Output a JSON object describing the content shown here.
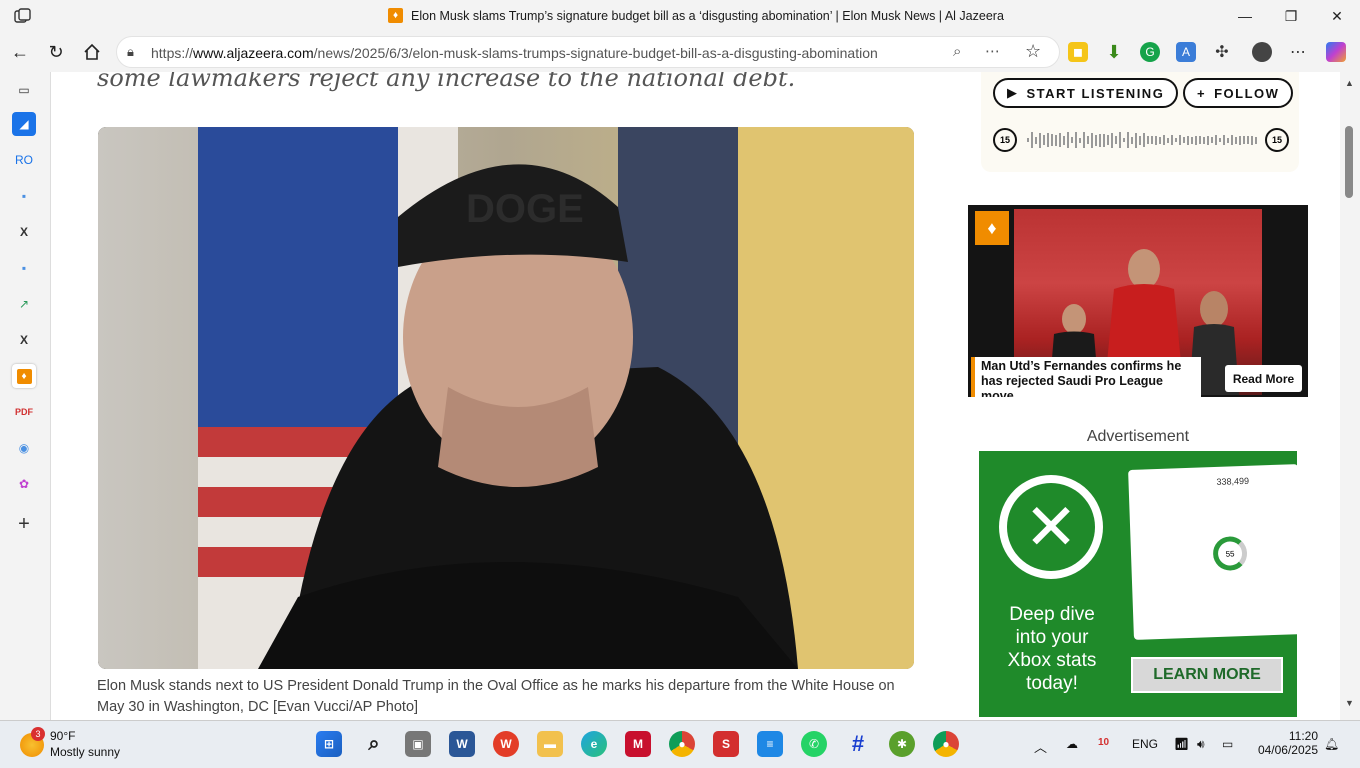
{
  "window": {
    "title": "Elon Musk slams Trump’s signature budget bill as a ‘disgusting abomination’ | Elon Musk News | Al Jazeera",
    "favicon_icon": "al-jazeera-icon"
  },
  "toolbar": {
    "url_prefix": "https://",
    "url_domain": "www.aljazeera.com",
    "url_path": "/news/2025/6/3/elon-musk-slams-trumps-signature-budget-bill-as-a-disgusting-abomination"
  },
  "article": {
    "deck": "some lawmakers reject any increase to the national debt.",
    "image_text": "DOGE",
    "caption": "Elon Musk stands next to US President Donald Trump in the Oval Office as he marks his departure from the White House on May 30 in Washington, DC [Evan Vucci/AP Photo]"
  },
  "audio": {
    "listen_label": "START LISTENING",
    "follow_label": "FOLLOW",
    "skip_back": "15",
    "skip_forward": "15"
  },
  "promo": {
    "headline": "Man Utd’s Fernandes confirms he has rejected Saudi Pro League move",
    "read_more": "Read More"
  },
  "ad": {
    "label": "Advertisement",
    "text": "Deep dive into your Xbox stats today!",
    "button": "LEARN MORE",
    "stat_number": "338,499",
    "ring_value": "55"
  },
  "taskbar": {
    "weather_badge": "3",
    "temperature": "90°F",
    "condition": "Mostly sunny",
    "language": "ENG",
    "time": "11:20",
    "date": "04/06/2025",
    "calendar_badge": "10"
  },
  "colors": {
    "aj_orange": "#f08c00",
    "xbox_green": "#1f8a2a"
  }
}
